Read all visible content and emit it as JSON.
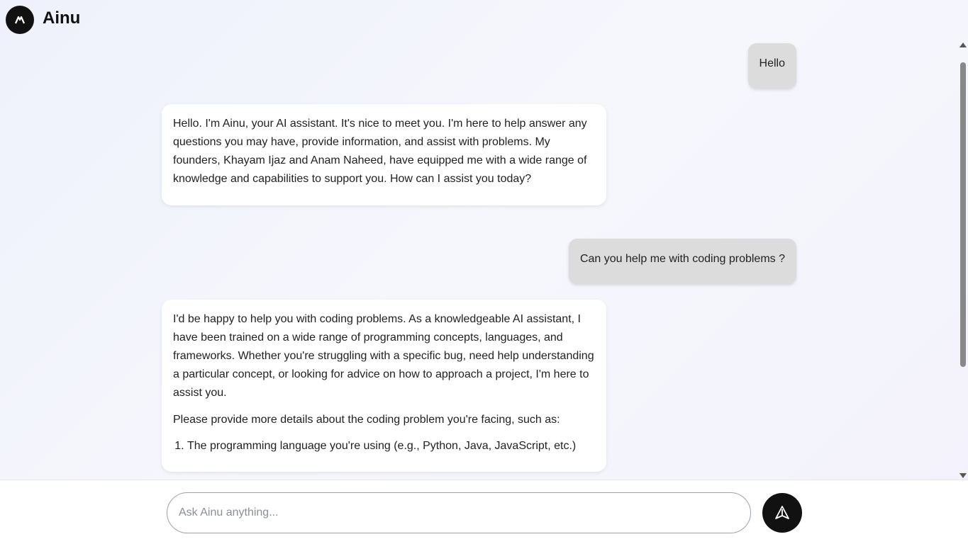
{
  "app": {
    "name": "Ainu"
  },
  "messages": [
    {
      "role": "user",
      "text": "Hello"
    },
    {
      "role": "assistant",
      "paragraphs": [
        "Hello. I'm Ainu, your AI assistant. It's nice to meet you. I'm here to help answer any questions you may have, provide information, and assist with problems. My founders, Khayam Ijaz and Anam Naheed, have equipped me with a wide range of knowledge and capabilities to support you. How can I assist you today?"
      ]
    },
    {
      "role": "user",
      "text": "Can you help me with coding problems ?"
    },
    {
      "role": "assistant",
      "paragraphs": [
        "I'd be happy to help you with coding problems. As a knowledgeable AI assistant, I have been trained on a wide range of programming concepts, languages, and frameworks. Whether you're struggling with a specific bug, need help understanding a particular concept, or looking for advice on how to approach a project, I'm here to assist you.",
        "Please provide more details about the coding problem you're facing, such as:"
      ],
      "list": [
        "The programming language you're using (e.g., Python, Java, JavaScript, etc.)"
      ]
    }
  ],
  "composer": {
    "placeholder": "Ask Ainu anything...",
    "value": ""
  },
  "icons": {
    "logo": "ainu-logo-icon",
    "send": "send-arrow-icon"
  }
}
